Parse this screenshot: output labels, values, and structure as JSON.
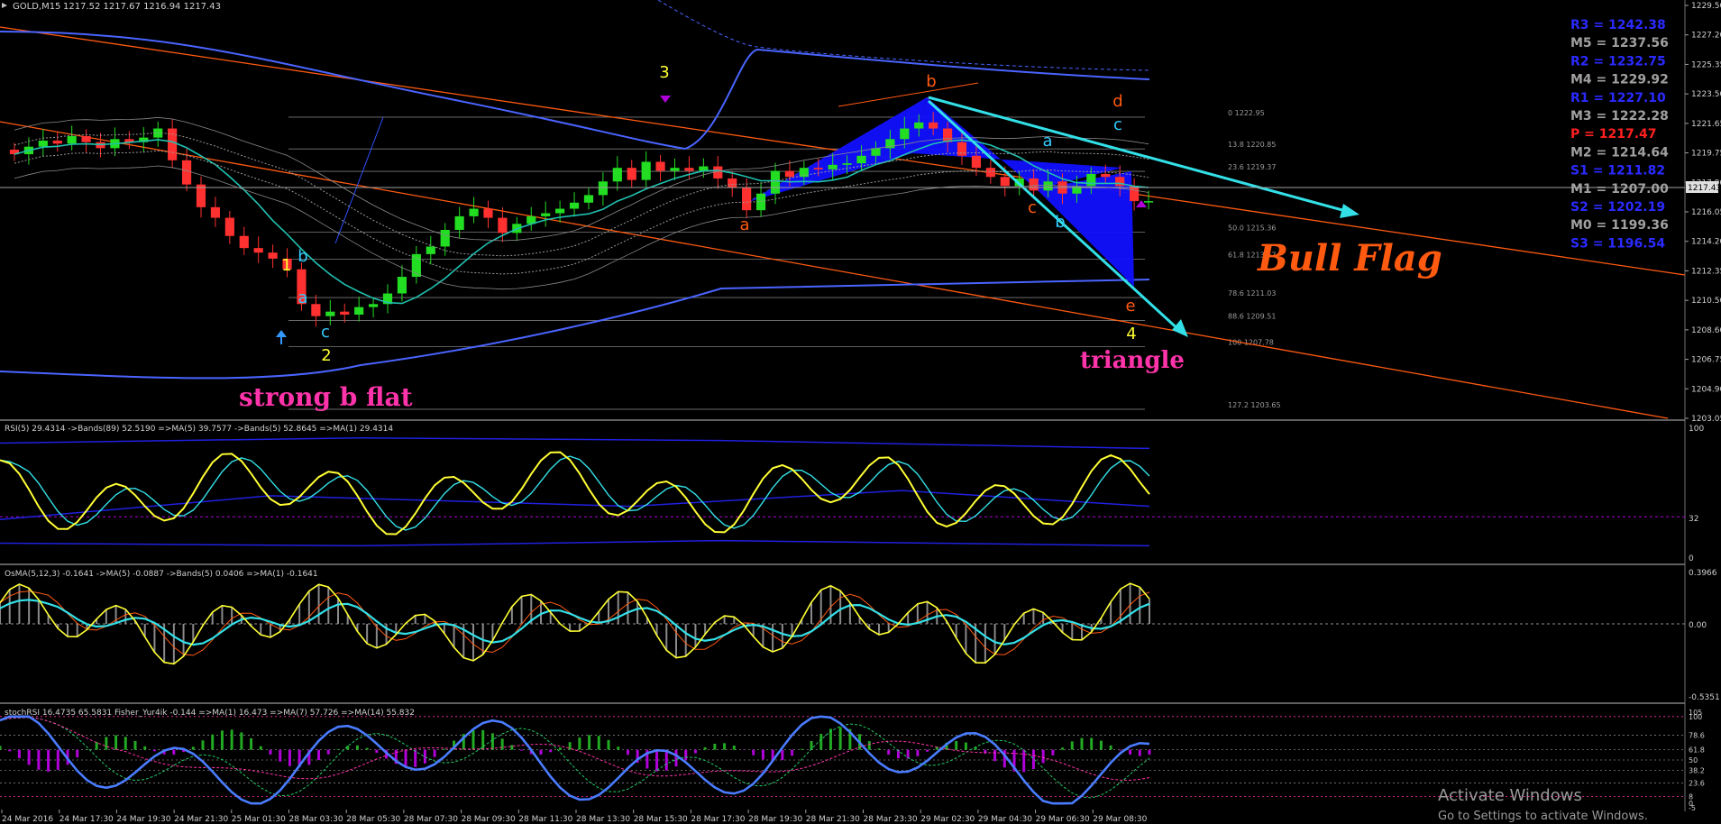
{
  "header": {
    "symbol_label": "GOLD,M15",
    "ohlc_label": "1217.52 1217.67 1216.94 1217.43"
  },
  "colors": {
    "background": "#000000",
    "bull": "#22dd22",
    "bear": "#ff3030",
    "yellow": "#ffff33",
    "cyan": "#33e0e8",
    "blue": "#2f50ff",
    "orange": "#ff5a10",
    "magenta": "#ff33aa",
    "purple": "#b000d8",
    "gray": "#808080"
  },
  "pivots": [
    {
      "label": "R3 = 1242.38",
      "color": "#2a2aff"
    },
    {
      "label": "M5 = 1237.56",
      "color": "#a0a0a0"
    },
    {
      "label": "R2 = 1232.75",
      "color": "#2a2aff"
    },
    {
      "label": "M4 = 1229.92",
      "color": "#a0a0a0"
    },
    {
      "label": "R1 = 1227.10",
      "color": "#2a2aff"
    },
    {
      "label": "M3 = 1222.28",
      "color": "#a0a0a0"
    },
    {
      "label": "P   = 1217.47",
      "color": "#ff2020"
    },
    {
      "label": "M2 = 1214.64",
      "color": "#a0a0a0"
    },
    {
      "label": "S1 = 1211.82",
      "color": "#2a2aff"
    },
    {
      "label": "M1 = 1207.00",
      "color": "#a0a0a0"
    },
    {
      "label": "S2 = 1202.19",
      "color": "#2a2aff"
    },
    {
      "label": "M0 = 1199.36",
      "color": "#a0a0a0"
    },
    {
      "label": "S3 = 1196.54",
      "color": "#2a2aff"
    }
  ],
  "fib_levels": [
    {
      "label": "0 1222.95",
      "price": 1222.95
    },
    {
      "label": "13.8 1220.85",
      "price": 1220.85
    },
    {
      "label": "23.6 1219.37",
      "price": 1219.37
    },
    {
      "label": "50.0 1215.36",
      "price": 1215.36
    },
    {
      "label": "61.8 1213.57",
      "price": 1213.57
    },
    {
      "label": "78.6 1211.03",
      "price": 1211.03
    },
    {
      "label": "88.6 1209.51",
      "price": 1209.51
    },
    {
      "label": "100 1207.78",
      "price": 1207.78
    },
    {
      "label": "127.2 1203.65",
      "price": 1203.65
    }
  ],
  "annotations": {
    "strong_b_flat": "strong b flat",
    "bull_flag": "Bull Flag",
    "triangle": "triangle",
    "wave_labels": [
      {
        "text": "1",
        "color": "#ffff33"
      },
      {
        "text": "b",
        "color": "#33ccff"
      },
      {
        "text": "a",
        "color": "#33ccff"
      },
      {
        "text": "c",
        "color": "#33ccff"
      },
      {
        "text": "2",
        "color": "#ffff33"
      },
      {
        "text": "3",
        "color": "#ffff33"
      },
      {
        "text": "a",
        "color": "#ff5a10"
      },
      {
        "text": "b",
        "color": "#ff5a10"
      },
      {
        "text": "d",
        "color": "#ff5a10"
      },
      {
        "text": "c",
        "color": "#33ccff"
      },
      {
        "text": "a",
        "color": "#33ccff"
      },
      {
        "text": "c",
        "color": "#ff5a10"
      },
      {
        "text": "b",
        "color": "#33ccff"
      },
      {
        "text": "e",
        "color": "#ff5a10"
      },
      {
        "text": "4",
        "color": "#ffff33"
      }
    ]
  },
  "current_price_label": "1217.43",
  "indicators": {
    "rsi_label": "RSI(5) 29.4314  ->Bands(89) 52.5190  =>MA(5) 39.7577  ->Bands(5) 52.8645  =>MA(1) 29.4314",
    "rsi_axis": [
      "100",
      "32",
      "0"
    ],
    "osma_label": "OsMA(5,12,3) -0.1641  ->MA(5) -0.0887  ->Bands(5) 0.0406  =>MA(1) -0.1641",
    "osma_axis": [
      "0.3966",
      "0.00",
      "-0.5351"
    ],
    "stoch_label": "stochRSI 16.4735 65.5831  Fisher_Yur4ik -0.144  =>MA(1) 16.473  =>MA(7) 57.726  =>MA(14) 55.832",
    "stoch_axis": [
      "105",
      "100",
      "78.6",
      "61.8",
      "50",
      "38.2",
      "23.6",
      "8",
      "0",
      "-5"
    ]
  },
  "watermark": {
    "line1": "Activate Windows",
    "line2": "Go to Settings to activate Windows."
  },
  "chart_data": {
    "type": "line",
    "title": "GOLD,M15",
    "price_axis_ticks": [
      "1229.50",
      "1227.20",
      "1225.35",
      "1223.50",
      "1221.65",
      "1219.75",
      "1217.90",
      "1216.05",
      "1214.20",
      "1212.35",
      "1210.50",
      "1208.60",
      "1206.75",
      "1204.90",
      "1203.05"
    ],
    "ylim": [
      1203.05,
      1229.5
    ],
    "time_axis_ticks": [
      "24 Mar 2016",
      "24 Mar 17:30",
      "24 Mar 19:30",
      "24 Mar 21:30",
      "25 Mar 01:30",
      "28 Mar 03:30",
      "28 Mar 05:30",
      "28 Mar 07:30",
      "28 Mar 09:30",
      "28 Mar 11:30",
      "28 Mar 13:30",
      "28 Mar 15:30",
      "28 Mar 17:30",
      "28 Mar 19:30",
      "28 Mar 21:30",
      "28 Mar 23:30",
      "29 Mar 02:30",
      "29 Mar 04:30",
      "29 Mar 06:30",
      "29 Mar 08:30"
    ],
    "series": [
      {
        "name": "GOLD,M15",
        "values": [
          1220.5,
          1221.0,
          1221.4,
          1221.2,
          1221.7,
          1221.3,
          1220.9,
          1221.5,
          1221.3,
          1221.6,
          1222.2,
          1220.1,
          1218.5,
          1217.0,
          1216.3,
          1215.1,
          1214.3,
          1214.0,
          1213.6,
          1212.9,
          1210.6,
          1209.8,
          1210.1,
          1209.9,
          1210.4,
          1210.6,
          1211.3,
          1212.4,
          1213.9,
          1214.4,
          1215.5,
          1216.4,
          1216.9,
          1216.3,
          1215.3,
          1215.9,
          1216.4,
          1216.6,
          1216.9,
          1217.3,
          1217.8,
          1218.7,
          1219.6,
          1218.8,
          1220.0,
          1219.4,
          1219.6,
          1219.4,
          1219.7,
          1218.9,
          1218.3,
          1216.8,
          1217.9,
          1219.4,
          1219.0,
          1219.6,
          1219.5,
          1219.8,
          1219.9,
          1220.4,
          1220.9,
          1221.5,
          1222.2,
          1222.6,
          1222.2,
          1221.3,
          1220.4,
          1219.6,
          1219.0,
          1218.4,
          1218.9,
          1218.1,
          1218.7,
          1217.9,
          1218.4,
          1219.2,
          1219.0,
          1218.4,
          1217.4,
          1217.4
        ]
      }
    ],
    "grid": false,
    "legend": "none"
  }
}
